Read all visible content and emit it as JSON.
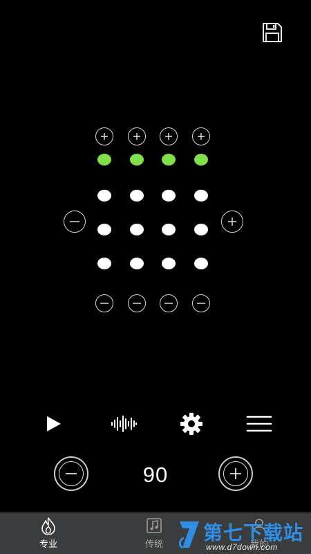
{
  "toolbar": {
    "save_icon": "floppy-disk-icon"
  },
  "beat_grid": {
    "columns": 4,
    "rows": 4,
    "accent_color": "#7fe04a",
    "normal_color": "#ffffff",
    "accent_row": [
      true,
      true,
      true,
      true
    ],
    "column_add_icon": "plus-circle-icon",
    "column_remove_icon": "minus-circle-icon",
    "row_add_icon": "plus-circle-icon",
    "row_remove_icon": "minus-circle-icon"
  },
  "controls": {
    "play_icon": "play-icon",
    "sound_icon": "waveform-icon",
    "settings_icon": "gear-icon",
    "menu_icon": "hamburger-menu-icon"
  },
  "tempo": {
    "value": "90",
    "decrease_icon": "minus-circle-icon",
    "increase_icon": "plus-circle-icon"
  },
  "bottom_nav": {
    "items": [
      {
        "label": "专业",
        "icon": "metronome-flame-icon",
        "active": true
      },
      {
        "label": "传统",
        "icon": "music-note-icon",
        "active": false
      },
      {
        "label": "我的",
        "icon": "person-icon",
        "active": false
      }
    ]
  },
  "watermark": {
    "title": "第七下载站",
    "url": "www.d7down.com"
  }
}
